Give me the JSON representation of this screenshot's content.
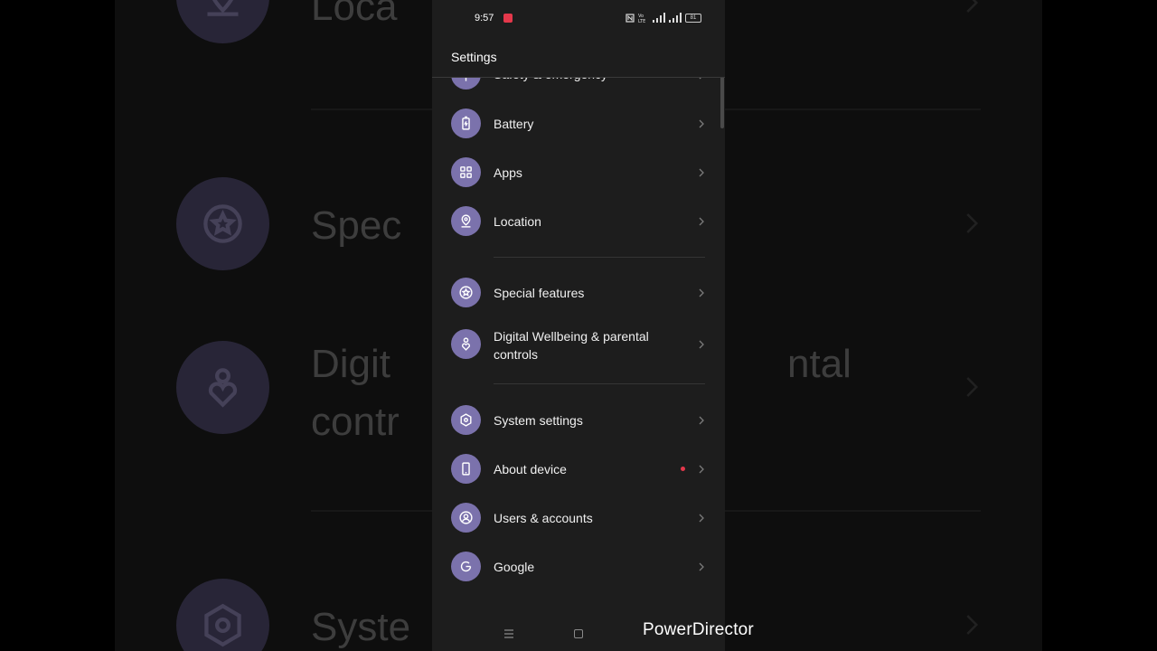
{
  "status_bar": {
    "time": "9:57",
    "battery_level": "81"
  },
  "header": {
    "title": "Settings"
  },
  "settings_items": [
    {
      "label": "Safety & emergency",
      "icon": "safety-icon"
    },
    {
      "label": "Battery",
      "icon": "battery-icon"
    },
    {
      "label": "Apps",
      "icon": "apps-grid-icon"
    },
    {
      "label": "Location",
      "icon": "location-pin-icon"
    },
    {
      "label": "Special features",
      "icon": "star-icon"
    },
    {
      "label": "Digital Wellbeing & parental controls",
      "icon": "heart-person-icon"
    },
    {
      "label": "System settings",
      "icon": "hexagon-gear-icon"
    },
    {
      "label": "About device",
      "icon": "phone-icon",
      "badge": "red-dot"
    },
    {
      "label": "Users & accounts",
      "icon": "user-circle-icon"
    },
    {
      "label": "Google",
      "icon": "google-g-icon"
    }
  ],
  "background_zoom": {
    "row1": "Loca",
    "row2": "Spec",
    "row3a": "Digit",
    "row3b": "ntal",
    "row3c": "contr",
    "row4": "Syste"
  },
  "watermark": "PowerDirector",
  "colors": {
    "icon_bg": "#7b72ac",
    "screen_bg": "#1d1d1d",
    "badge": "#e4384b"
  }
}
